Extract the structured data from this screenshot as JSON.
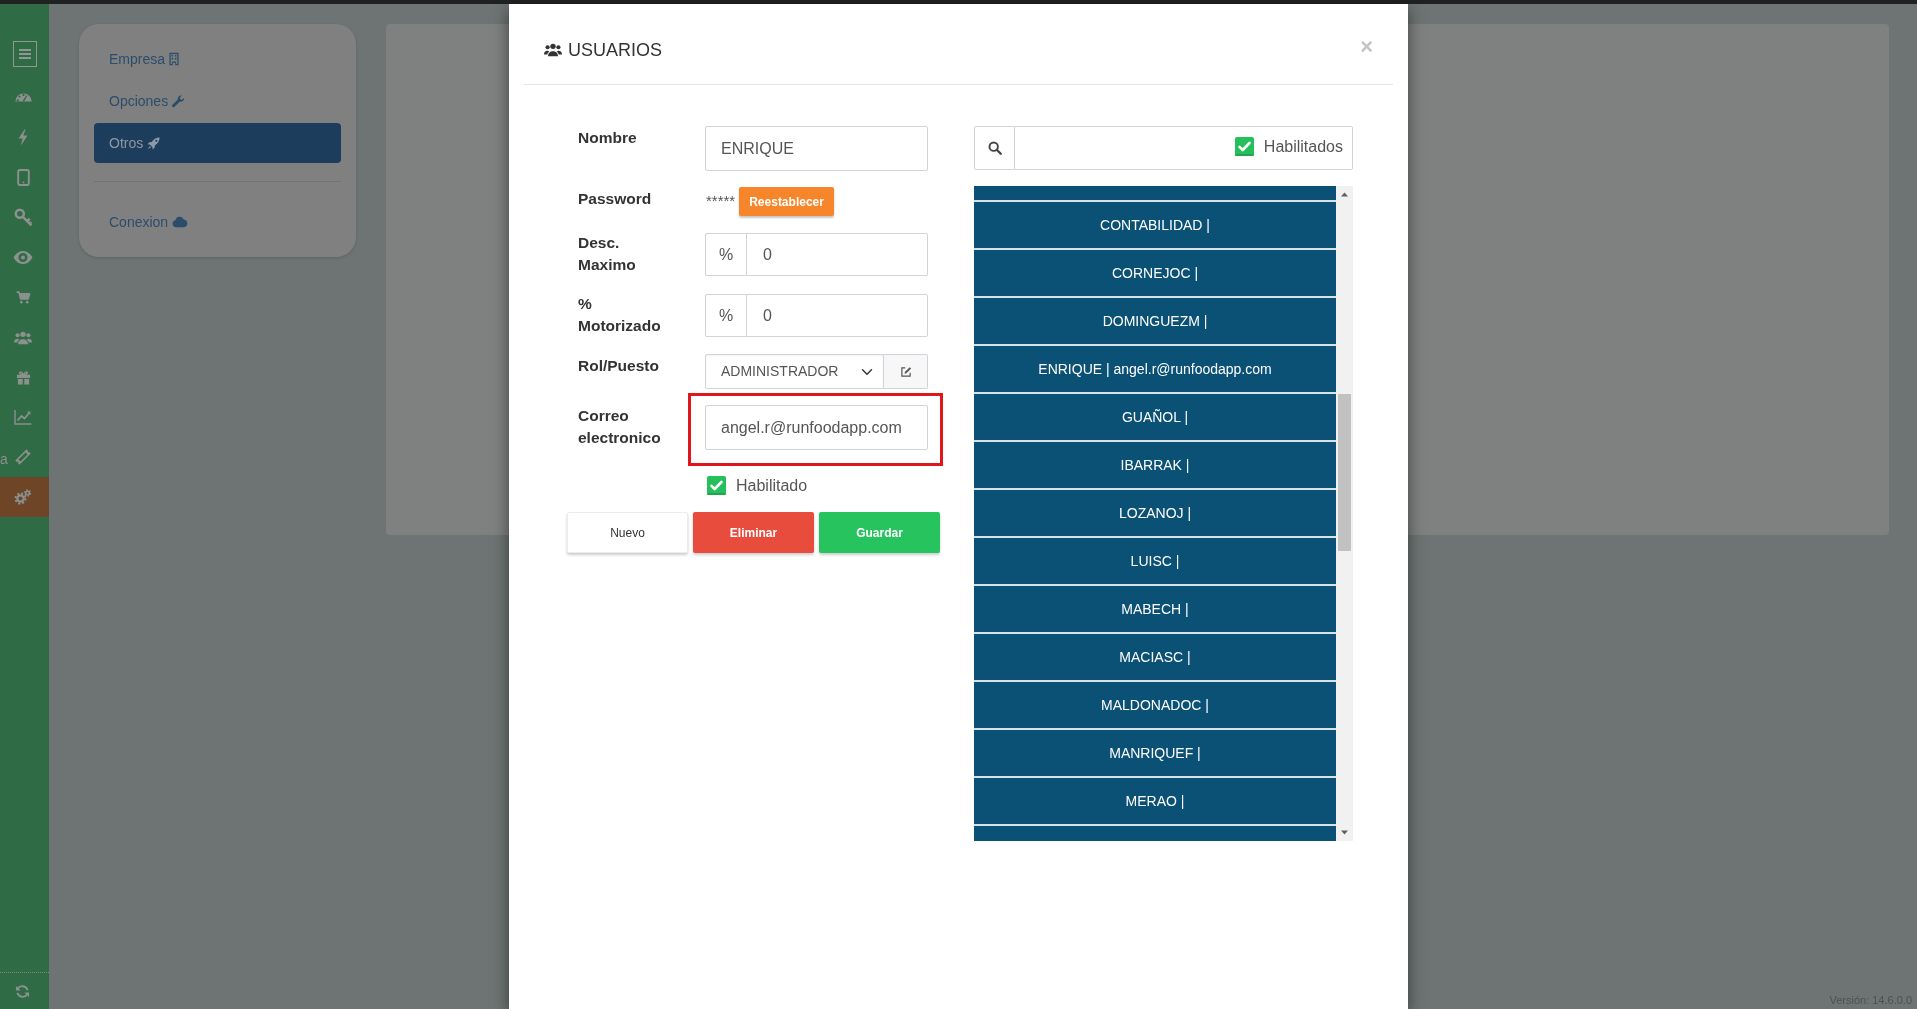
{
  "sidebar": {
    "items": [
      {
        "selected": false
      },
      {
        "selected": false
      },
      {
        "selected": false
      },
      {
        "selected": false
      },
      {
        "selected": false
      },
      {
        "selected": false
      },
      {
        "selected": false
      },
      {
        "selected": false
      },
      {
        "selected": false
      },
      {
        "selected": false,
        "clipped_label": "a"
      },
      {
        "selected": true
      }
    ]
  },
  "settings_menu": {
    "groups": [
      {
        "items": [
          {
            "label": "Empresa",
            "selected": false
          },
          {
            "label": "Opciones",
            "selected": false
          },
          {
            "label": "Otros",
            "selected": true
          }
        ]
      },
      {
        "items": [
          {
            "label": "Conexion",
            "selected": false
          }
        ]
      }
    ]
  },
  "modal": {
    "title": "USUARIOS",
    "close_label": "×",
    "form": {
      "fields": [
        {
          "kind": "text",
          "label": "Nombre",
          "value": "ENRIQUE",
          "highlighted": false
        },
        {
          "kind": "password",
          "label": "Password",
          "masked": "*****",
          "button": "Reestablecer",
          "highlighted": false
        },
        {
          "kind": "addon",
          "label": "Desc. Maximo",
          "addon": "%",
          "value": "0",
          "highlighted": false
        },
        {
          "kind": "addon",
          "label": "% Motorizado",
          "addon": "%",
          "value": "0",
          "highlighted": false
        },
        {
          "kind": "select",
          "label": "Rol/Puesto",
          "value": "ADMINISTRADOR",
          "highlighted": false
        },
        {
          "kind": "text",
          "label": "Correo electronico",
          "value": "angel.r@runfoodapp.com",
          "highlighted": true
        },
        {
          "kind": "checkbox",
          "label": "Habilitado",
          "checked": true,
          "highlighted": false
        }
      ],
      "buttons": [
        {
          "kind": "default",
          "label": "Nuevo"
        },
        {
          "kind": "danger",
          "label": "Eliminar"
        },
        {
          "kind": "success",
          "label": "Guardar"
        }
      ]
    },
    "user_search": {
      "filter_label": "Habilitados",
      "filter_checked": true
    },
    "user_list": {
      "clipped_above": true,
      "clipped_below": true,
      "items": [
        {
          "label": "CONTABILIDAD |"
        },
        {
          "label": "CORNEJOC |"
        },
        {
          "label": "DOMINGUEZM |"
        },
        {
          "label": "ENRIQUE | angel.r@runfoodapp.com"
        },
        {
          "label": "GUAÑOL |"
        },
        {
          "label": "IBARRAK |"
        },
        {
          "label": "LOZANOJ |"
        },
        {
          "label": "LUISC |"
        },
        {
          "label": "MABECH |"
        },
        {
          "label": "MACIASC |"
        },
        {
          "label": "MALDONADOC |"
        },
        {
          "label": "MANRIQUEF |"
        },
        {
          "label": "MERAO |"
        }
      ]
    }
  },
  "version": "Versión: 14.6.0.0"
}
